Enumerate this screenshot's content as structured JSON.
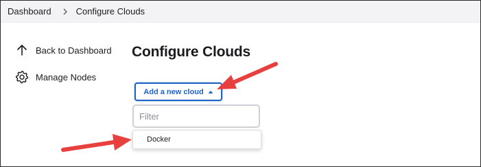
{
  "breadcrumb": {
    "items": [
      {
        "label": "Dashboard"
      },
      {
        "label": "Configure Clouds"
      }
    ]
  },
  "sidebar": {
    "items": [
      {
        "label": "Back to Dashboard",
        "icon": "arrow-up-icon"
      },
      {
        "label": "Manage Nodes",
        "icon": "gear-icon"
      }
    ]
  },
  "main": {
    "title": "Configure Clouds",
    "add_button_label": "Add a new cloud",
    "filter_placeholder": "Filter",
    "dropdown_items": [
      {
        "label": "Docker"
      }
    ]
  },
  "annotations": {
    "arrow_color": "#e8403e"
  },
  "colors": {
    "accent": "#1f62c8",
    "topbar_bg": "#f3f3f5"
  }
}
